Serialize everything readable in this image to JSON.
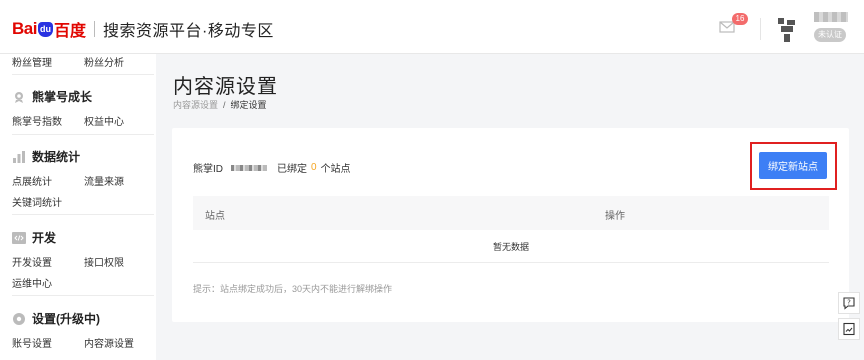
{
  "header": {
    "logo_bai": "Bai",
    "logo_du": "du",
    "logo_cn": "百度",
    "title": "搜索资源平台·移动专区",
    "message_count": "16",
    "cert_status": "未认证"
  },
  "sidebar": {
    "top_items": [
      "粉丝管理",
      "粉丝分析"
    ],
    "groups": [
      {
        "title": "熊掌号成长",
        "icon": "bear-paw-icon",
        "items": [
          "熊掌号指数",
          "权益中心"
        ]
      },
      {
        "title": "数据统计",
        "icon": "bar-chart-icon",
        "items": [
          "点展统计",
          "流量来源",
          "关键词统计"
        ]
      },
      {
        "title": "开发",
        "icon": "code-icon",
        "items": [
          "开发设置",
          "接口权限",
          "运维中心"
        ]
      },
      {
        "title": "设置(升级中)",
        "icon": "gear-icon",
        "items": [
          "账号设置",
          "内容源设置"
        ]
      }
    ]
  },
  "main": {
    "page_title": "内容源设置",
    "breadcrumb": [
      "内容源设置",
      "/",
      "绑定设置"
    ],
    "info": {
      "id_label": "熊掌ID",
      "bound_prefix": "已绑定",
      "bound_count": "0",
      "bound_suffix": "个站点"
    },
    "bind_button": "绑定新站点",
    "table": {
      "columns": [
        "站点",
        "操作"
      ],
      "empty_text": "暂无数据"
    },
    "tip": "提示：站点绑定成功后，30天内不能进行解绑操作"
  },
  "colors": {
    "accent": "#3d7ff5",
    "highlight": "#e02020",
    "count": "#f5a623",
    "baidu_red": "#e10601"
  }
}
